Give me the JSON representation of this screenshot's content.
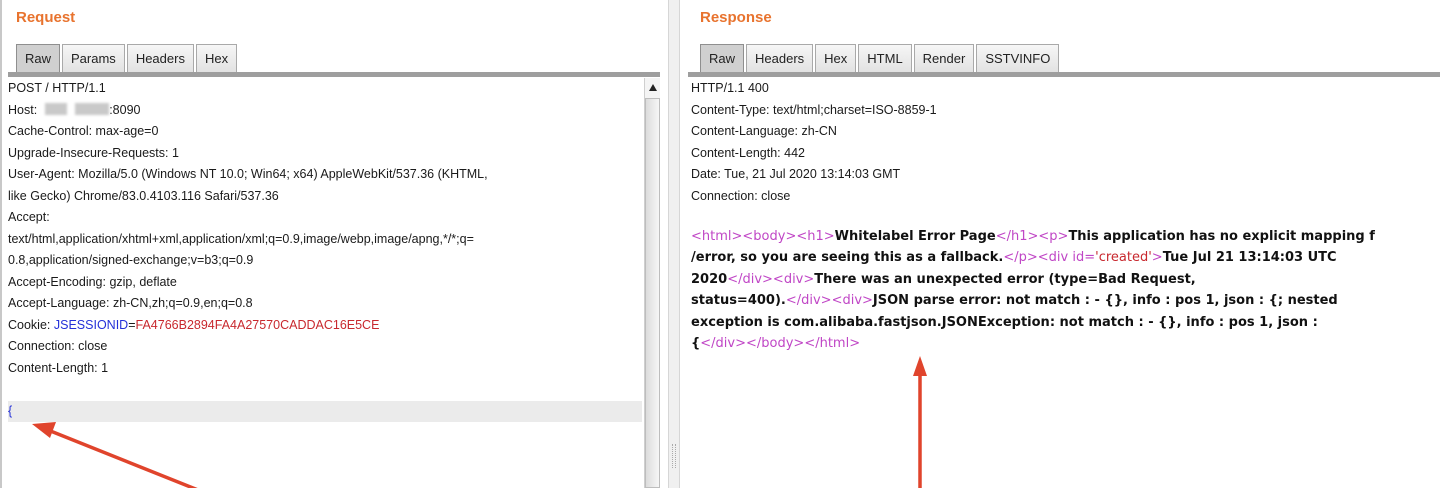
{
  "request": {
    "title": "Request",
    "tabs": [
      "Raw",
      "Params",
      "Headers",
      "Hex"
    ],
    "active_tab": "Raw",
    "lines": {
      "request_line": "POST / HTTP/1.1",
      "host_label": "Host:",
      "host_port": ":8090",
      "cache_control": "Cache-Control: max-age=0",
      "upgrade": "Upgrade-Insecure-Requests: 1",
      "user_agent_1": "User-Agent: Mozilla/5.0 (Windows NT 10.0; Win64; x64) AppleWebKit/537.36 (KHTML,",
      "user_agent_2": "like Gecko) Chrome/83.0.4103.116 Safari/537.36",
      "accept_label": "Accept:",
      "accept_1": "text/html,application/xhtml+xml,application/xml;q=0.9,image/webp,image/apng,*/*;q=",
      "accept_2": "0.8,application/signed-exchange;v=b3;q=0.9",
      "accept_encoding": "Accept-Encoding: gzip, deflate",
      "accept_language": "Accept-Language: zh-CN,zh;q=0.9,en;q=0.8",
      "cookie_label": "Cookie:",
      "cookie_name": "JSESSIONID",
      "cookie_eq": "=",
      "cookie_value": "FA4766B2894FA4A27570CADDAC16E5CE",
      "connection": "Connection: close",
      "content_length": "Content-Length: 1",
      "body": "{"
    }
  },
  "response": {
    "title": "Response",
    "tabs": [
      "Raw",
      "Headers",
      "Hex",
      "HTML",
      "Render",
      "SSTVINFO"
    ],
    "active_tab": "Raw",
    "lines": {
      "status": "HTTP/1.1 400",
      "content_type": "Content-Type: text/html;charset=ISO-8859-1",
      "content_language": "Content-Language: zh-CN",
      "content_length": "Content-Length: 442",
      "date": "Date: Tue, 21 Jul 2020 13:14:03 GMT",
      "connection": "Connection: close"
    },
    "html_body": {
      "t_html": "<html>",
      "t_body": "<body>",
      "t_h1": "<h1>",
      "h1_text": "Whitelabel Error Page",
      "t_h1_close": "</h1>",
      "t_p": "<p>",
      "p_text_1": "This application has no explicit mapping f",
      "p_text_2": "/error, so you are seeing this as a fallback.",
      "t_p_close": "</p>",
      "t_div_open": "<div ",
      "attr_name": "id=",
      "attr_value": "'created'",
      "t_gt": ">",
      "created_1": "Tue Jul 21 13:14:03 UTC",
      "created_2": "2020",
      "t_div_close": "</div>",
      "t_div": "<div>",
      "error_1": "There was an unexpected error (type=Bad Request,",
      "error_2": "status=400).",
      "json_1": "JSON parse error: not match : - {}, info : pos 1, json : {; nested",
      "json_2": "exception is com.alibaba.fastjson.JSONException: not match : - {}, info : pos 1, json :",
      "json_3": "{",
      "t_body_close": "</body>",
      "t_html_close": "</html>"
    }
  },
  "colors": {
    "title_orange": "#e8732e",
    "arrow_red": "#e0442c",
    "keyword_blue": "#2430d8",
    "value_red": "#c8282e",
    "tag_magenta": "#c046c6"
  }
}
